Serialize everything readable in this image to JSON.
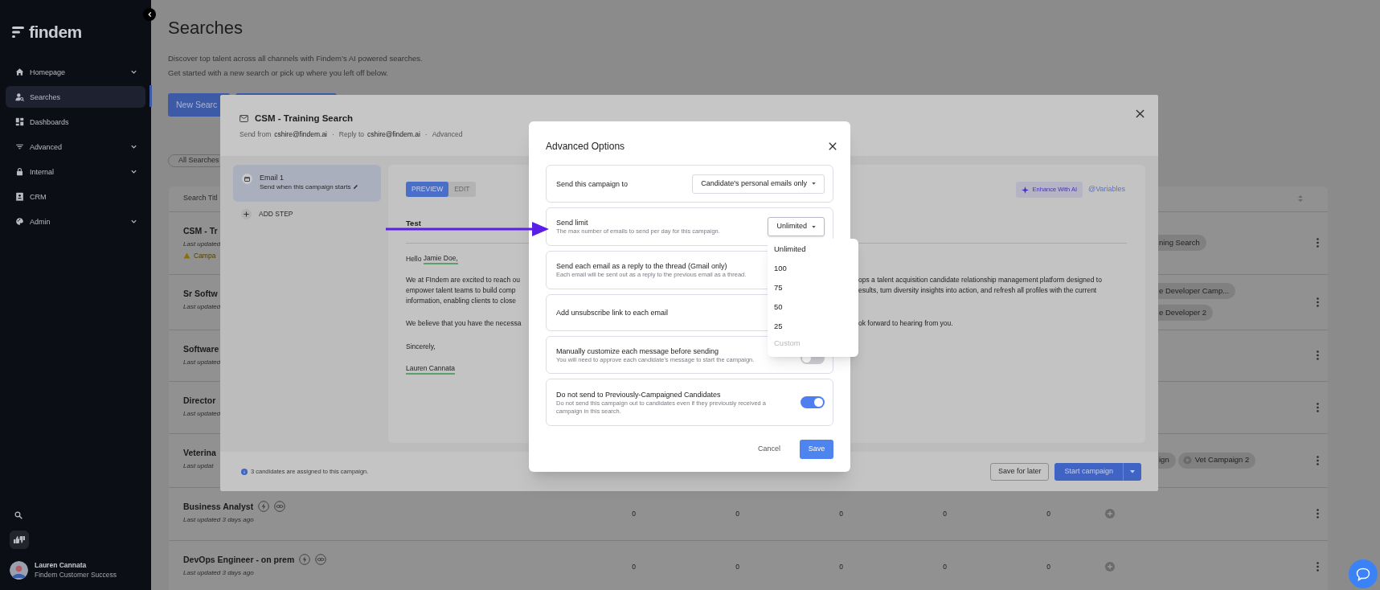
{
  "sidebar": {
    "logo": "findem",
    "items": [
      {
        "label": "Homepage",
        "expandable": true,
        "selected": false
      },
      {
        "label": "Searches",
        "expandable": false,
        "selected": true
      },
      {
        "label": "Dashboards",
        "expandable": false,
        "selected": false
      },
      {
        "label": "Advanced",
        "expandable": true,
        "selected": false
      },
      {
        "label": "Internal",
        "expandable": true,
        "selected": false
      },
      {
        "label": "CRM",
        "expandable": false,
        "selected": false
      },
      {
        "label": "Admin",
        "expandable": true,
        "selected": false
      }
    ],
    "user": {
      "name": "Lauren Cannata",
      "role": "Findem Customer Success"
    }
  },
  "page": {
    "title": "Searches",
    "description": [
      "Discover top talent across all channels with Findem’s AI powered searches.",
      "Get started with a new search or pick up where you left off below."
    ],
    "new_search_button": "New Searc",
    "filter_chip": "All Searches",
    "table": {
      "columns": [
        "Search Titl"
      ],
      "rows": [
        {
          "title": "CSM - Tr",
          "updated": "Last updated",
          "warning": "Campa",
          "campaigns": [
            {
              "label": "ning Search",
              "status_icon": false
            }
          ]
        },
        {
          "title": "Sr Softw",
          "updated": "Last updated",
          "campaigns": [
            {
              "label": "e Developer Camp...",
              "status_icon": false
            },
            {
              "label": "e Developer 2",
              "status_icon": false
            }
          ]
        },
        {
          "title": "Software",
          "updated": "Last updated"
        },
        {
          "title": "Director",
          "updated": "Last updated"
        },
        {
          "title": "Veterina",
          "updated": "Last updat",
          "campaigns": [
            {
              "label": "ign",
              "status_icon": false
            },
            {
              "label": "Vet Campaign 2",
              "status_icon": true
            }
          ]
        },
        {
          "title": "Business Analyst",
          "updated": "Last updated 3 days ago",
          "counts": [
            "0",
            "0",
            "0",
            "0",
            "0"
          ]
        },
        {
          "title": "DevOps Engineer - on prem",
          "updated": "Last updated 3 days ago",
          "counts": [
            "0",
            "0",
            "0",
            "0",
            "0"
          ]
        }
      ]
    }
  },
  "campaign_modal": {
    "title": "CSM - Training Search",
    "meta": [
      {
        "kind": "field",
        "label": "Send from",
        "value": "cshire@findem.ai"
      },
      {
        "kind": "dot",
        "text": "·"
      },
      {
        "kind": "field",
        "label": "Reply to",
        "value": "cshire@findem.ai"
      },
      {
        "kind": "dot",
        "text": "·"
      },
      {
        "kind": "link",
        "text": "Advanced"
      }
    ],
    "steps": [
      {
        "title": "Email 1",
        "subtitle": "Send when this campaign starts",
        "selected": true
      }
    ],
    "add_step": "ADD STEP",
    "tabs": [
      {
        "label": "PREVIEW",
        "selected": true
      },
      {
        "label": "EDIT",
        "selected": false
      }
    ],
    "enhance_button": "Enhance With AI",
    "variables_link": "@Variables",
    "subject": "Test",
    "body": [
      {
        "lines": [
          {
            "text": "Hello ",
            "variable": "Jamie Doe,"
          }
        ]
      },
      {
        "lines": [
          {
            "left": "We at FIndem are excited to reach ou",
            "right": "ops a talent acquisition candidate relationship management platform designed to"
          },
          {
            "left": "empower talent teams to build comp",
            "right": "esults, turn diversity insights into action, and refresh all profiles with the current"
          },
          {
            "left": "information, enabling clients to close"
          }
        ]
      },
      {
        "lines": [
          {
            "left": "We believe that you have the necessa",
            "right": "ok forward to hearing from you."
          }
        ]
      },
      {
        "lines": [
          {
            "left": "Sincerely,"
          }
        ]
      },
      {
        "lines": [
          {
            "variable": "Lauren Cannata"
          }
        ]
      }
    ],
    "footer": {
      "info": "3 candidates are assigned to this campaign.",
      "buttons": [
        {
          "label": "Save for later",
          "kind": "secondary"
        },
        {
          "label": "Start campaign",
          "kind": "primary"
        }
      ]
    }
  },
  "advanced_options": {
    "title": "Advanced Options",
    "options": [
      {
        "kind": "select",
        "label": "Send this campaign to",
        "value": "Candidate's personal emails only",
        "open": false
      },
      {
        "kind": "select",
        "label": "Send limit",
        "description": "The max number of emails to send per day for this campaign.",
        "value": "Unlimited",
        "open": true
      },
      {
        "kind": "plain",
        "label": "Send each email as a reply to the thread (Gmail only)",
        "description": "Each email will be sent out as a reply to the previous email as a thread."
      },
      {
        "kind": "plain",
        "label": "Add unsubscribe link to each email"
      },
      {
        "kind": "toggle",
        "label": "Manually customize each message before sending",
        "description": "You will need to approve each candidate's message to start the campaign.",
        "on": false
      },
      {
        "kind": "toggle",
        "label": "Do not send to Previously-Campaigned Candidates",
        "description": "Do not send this campaign out to candidates even if they previously received a campaign in this search.",
        "on": true
      }
    ],
    "buttons": [
      {
        "label": "Cancel",
        "kind": "text"
      },
      {
        "label": "Save",
        "kind": "primary"
      }
    ],
    "menu": {
      "items": [
        {
          "label": "Unlimited",
          "disabled": false
        },
        {
          "label": "100",
          "disabled": false
        },
        {
          "label": "75",
          "disabled": false
        },
        {
          "label": "50",
          "disabled": false
        },
        {
          "label": "25",
          "disabled": false
        },
        {
          "label": "Custom",
          "disabled": true
        }
      ]
    }
  }
}
